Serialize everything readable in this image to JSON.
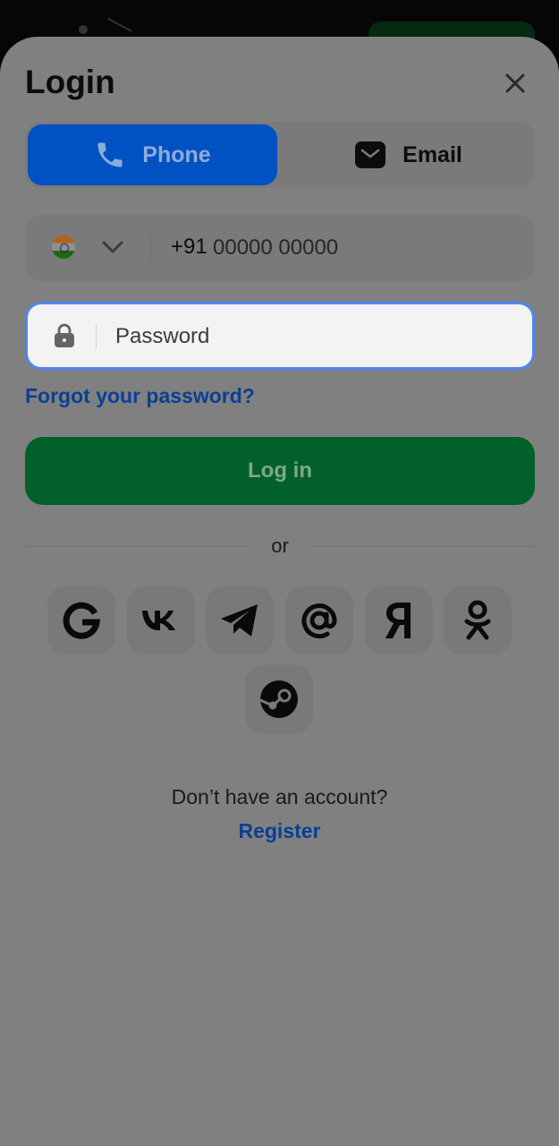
{
  "header": {
    "title": "Login"
  },
  "tabs": [
    {
      "label": "Phone",
      "icon": "phone-icon",
      "active": true
    },
    {
      "label": "Email",
      "icon": "mail-icon",
      "active": false
    }
  ],
  "phone": {
    "country_flag": "india-flag-icon",
    "prefix": "+91",
    "placeholder": "00000 00000"
  },
  "password": {
    "placeholder": "Password"
  },
  "forgot_label": "Forgot your password?",
  "login_label": "Log in",
  "divider_label": "or",
  "social": [
    {
      "name": "google",
      "icon": "google-icon"
    },
    {
      "name": "vk",
      "icon": "vk-icon"
    },
    {
      "name": "telegram",
      "icon": "telegram-icon"
    },
    {
      "name": "mail-ru",
      "icon": "at-sign-icon"
    },
    {
      "name": "yandex",
      "icon": "yandex-icon"
    },
    {
      "name": "odnoklassniki",
      "icon": "odnoklassniki-icon"
    },
    {
      "name": "steam",
      "icon": "steam-icon"
    }
  ],
  "footer": {
    "no_account": "Don’t have an account?",
    "register_label": "Register"
  },
  "colors": {
    "overlay": "#808080",
    "accent_blue": "#0051c2",
    "login_green": "#02602a",
    "link": "#0a3f93",
    "focus_border": "#4f86f0"
  }
}
